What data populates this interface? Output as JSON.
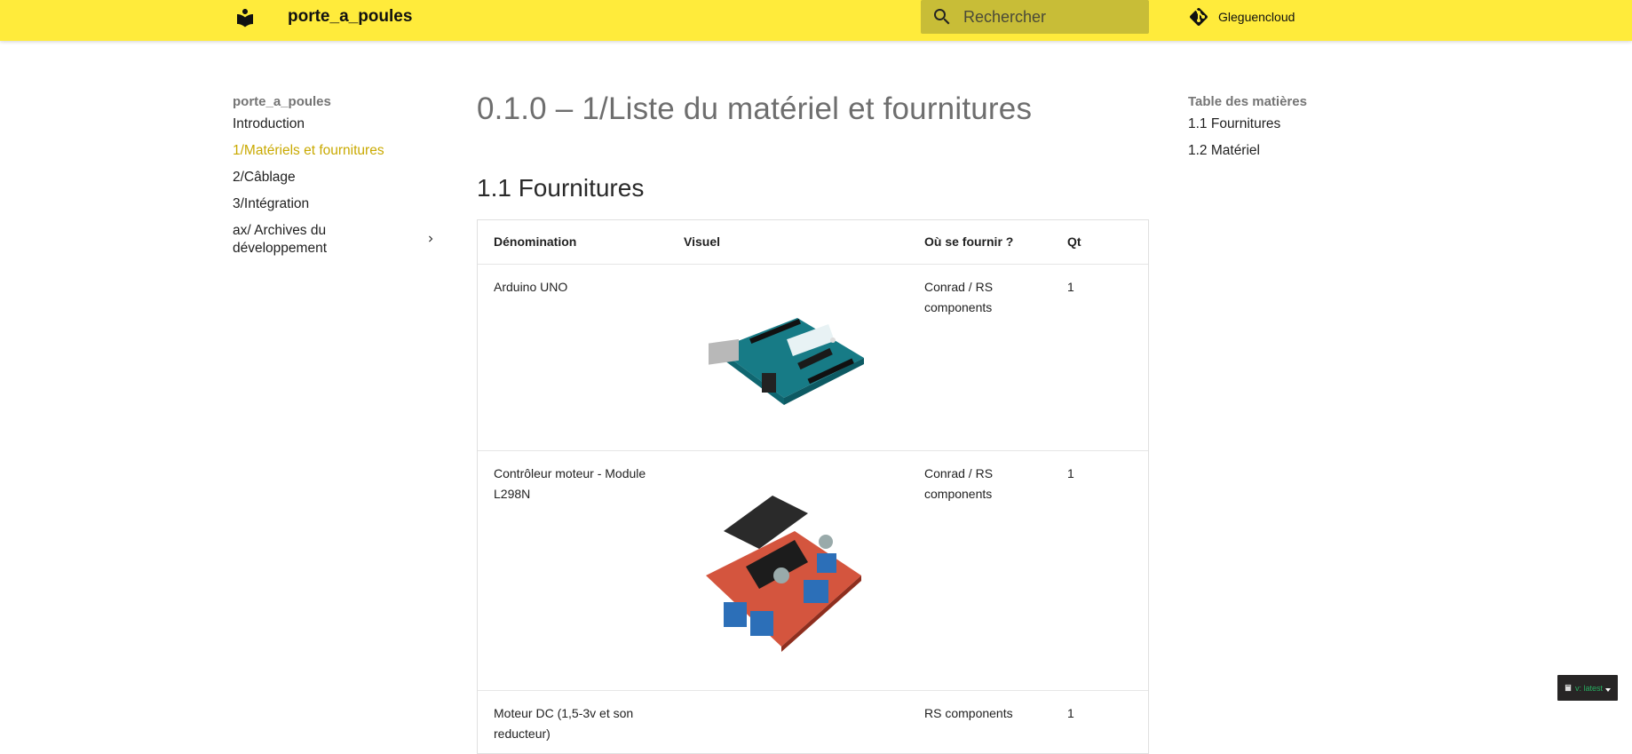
{
  "header": {
    "site_title": "porte_a_poules",
    "search_placeholder": "Rechercher",
    "repo_name": "Gleguencloud",
    "background_color": "#ffeb3b"
  },
  "nav": {
    "title": "porte_a_poules",
    "items": [
      {
        "label": "Introduction",
        "active": false
      },
      {
        "label": "1/Matériels et fournitures",
        "active": true
      },
      {
        "label": "2/Câblage",
        "active": false
      },
      {
        "label": "3/Intégration",
        "active": false
      },
      {
        "label": "ax/ Archives du développement",
        "active": false,
        "expandable": true
      }
    ],
    "active_color": "#c9a900"
  },
  "main": {
    "page_title": "0.1.0 – 1/Liste du matériel et fournitures",
    "section_title": "1.1 Fournitures",
    "table": {
      "headers": [
        "Dénomination",
        "Visuel",
        "Où se fournir ?",
        "Qt"
      ],
      "rows": [
        {
          "name": "Arduino UNO",
          "visual_icon": "arduino-uno-image",
          "supplier": "Conrad / RS components",
          "qty": "1"
        },
        {
          "name": "Contrôleur moteur - Module L298N",
          "visual_icon": "l298n-module-image",
          "supplier": "Conrad / RS components",
          "qty": "1"
        },
        {
          "name": "Moteur DC (1,5-3v et son reducteur)",
          "visual_icon": "",
          "supplier": "RS components",
          "qty": "1"
        }
      ]
    }
  },
  "toc": {
    "title": "Table des matières",
    "items": [
      "1.1 Fournitures",
      "1.2 Matériel"
    ]
  },
  "version_badge": {
    "label": "v: latest"
  }
}
